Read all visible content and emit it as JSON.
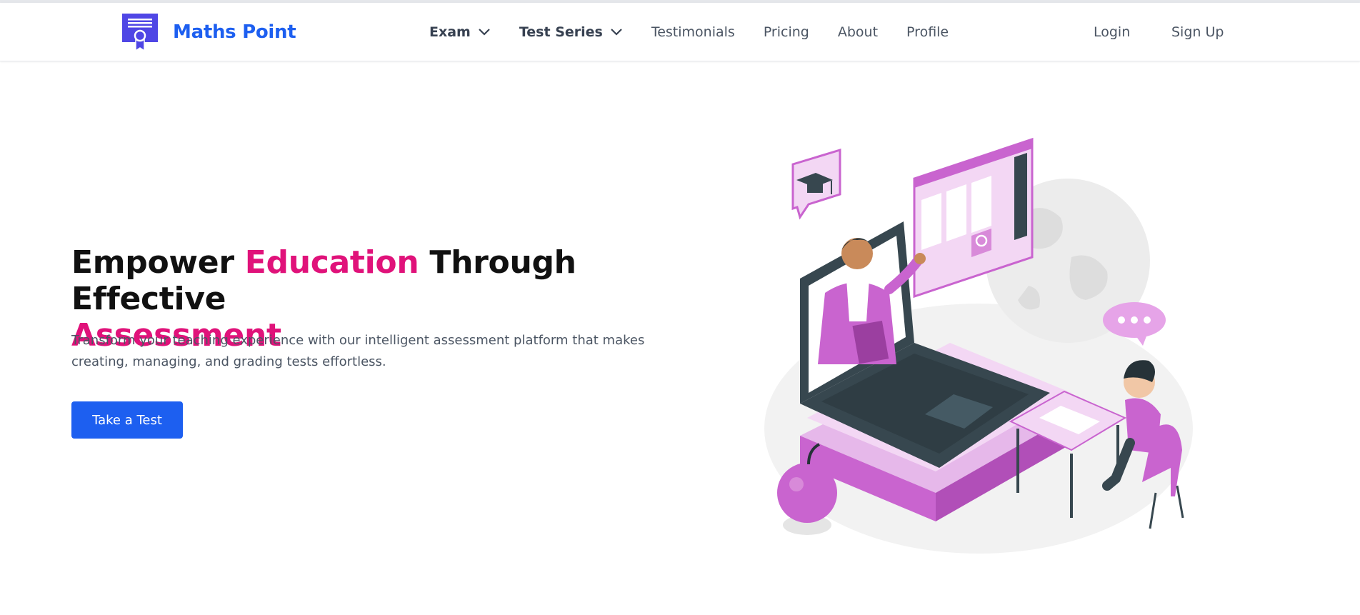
{
  "brand": {
    "name": "Maths Point",
    "icon": "certificate-ribbon-icon"
  },
  "nav": {
    "items": [
      {
        "label": "Exam",
        "dropdown": true
      },
      {
        "label": "Test Series",
        "dropdown": true
      },
      {
        "label": "Testimonials",
        "dropdown": false
      },
      {
        "label": "Pricing",
        "dropdown": false
      },
      {
        "label": "About",
        "dropdown": false
      },
      {
        "label": "Profile",
        "dropdown": false
      }
    ],
    "login": "Login",
    "signup": "Sign Up"
  },
  "hero": {
    "title_part1": "Empower ",
    "title_accent1": "Education",
    "title_part2": " Through Effective",
    "title_accent2": "Assessment",
    "subtitle": "Transform your teaching experience with our intelligent assessment platform that makes creating, managing, and grading tests effortless.",
    "cta_label": "Take a Test"
  },
  "colors": {
    "brand": "#1d5ff0",
    "accent": "#e0127a",
    "illustration_purple": "#c964cf",
    "illustration_dark": "#37474f"
  }
}
